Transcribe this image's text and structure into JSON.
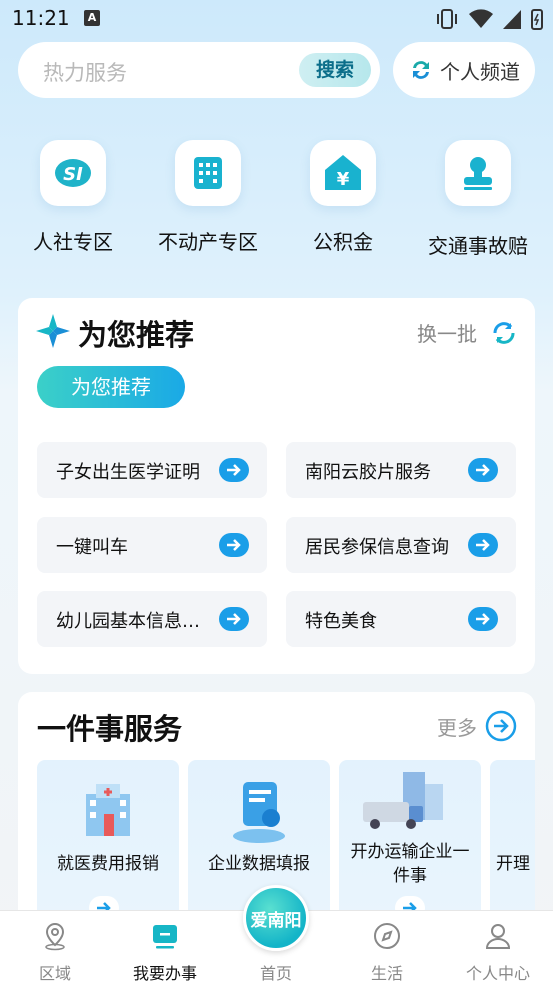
{
  "status_bar": {
    "time": "11:21",
    "notification_letter": "A"
  },
  "search": {
    "placeholder": "热力服务",
    "button_label": "搜索"
  },
  "channel": {
    "label": "个人频道"
  },
  "quick_services": [
    {
      "label": "人社专区",
      "icon": "social-security-icon"
    },
    {
      "label": "不动产专区",
      "icon": "building-icon"
    },
    {
      "label": "公积金",
      "icon": "housing-fund-icon"
    },
    {
      "label": "交通事故赔",
      "icon": "stamp-icon"
    }
  ],
  "recommend": {
    "title": "为您推荐",
    "refresh_label": "换一批",
    "tab_label": "为您推荐",
    "items": [
      {
        "label": "子女出生医学证明"
      },
      {
        "label": "南阳云胶片服务"
      },
      {
        "label": "一键叫车"
      },
      {
        "label": "居民参保信息查询"
      },
      {
        "label": "幼儿园基本信息查..."
      },
      {
        "label": "特色美食"
      }
    ]
  },
  "services": {
    "title": "一件事服务",
    "more_label": "更多",
    "tiles": [
      {
        "label": "就医费用报销"
      },
      {
        "label": "企业数据填报"
      },
      {
        "label": "开办运输企业一件事"
      },
      {
        "label": "开理"
      }
    ]
  },
  "bottom_nav": {
    "items": [
      {
        "label": "区域"
      },
      {
        "label": "我要办事"
      },
      {
        "label": "首页"
      },
      {
        "label": "生活"
      },
      {
        "label": "个人中心"
      }
    ],
    "home_badge": "爱南阳"
  },
  "colors": {
    "accent": "#1a9ee8",
    "teal": "#3bd0c8"
  }
}
